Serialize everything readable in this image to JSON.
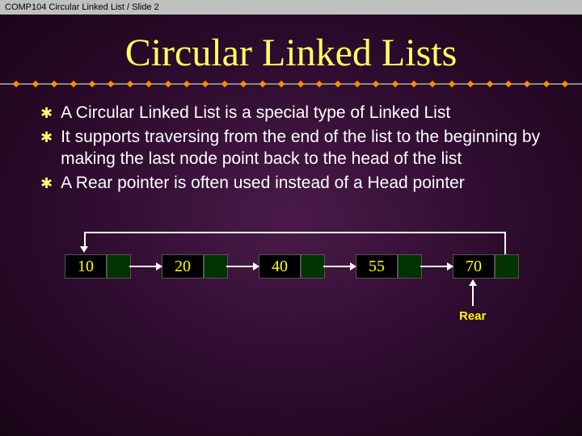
{
  "header": "COMP104 Circular Linked List / Slide 2",
  "title": "Circular Linked Lists",
  "bullets": [
    "A Circular Linked List is a special type of Linked List",
    "It supports traversing from the end of the list to the beginning by making the last node point back to the head of the list",
    "A Rear pointer is often used instead of a Head pointer"
  ],
  "nodes": [
    "10",
    "20",
    "40",
    "55",
    "70"
  ],
  "rear_label": "Rear"
}
